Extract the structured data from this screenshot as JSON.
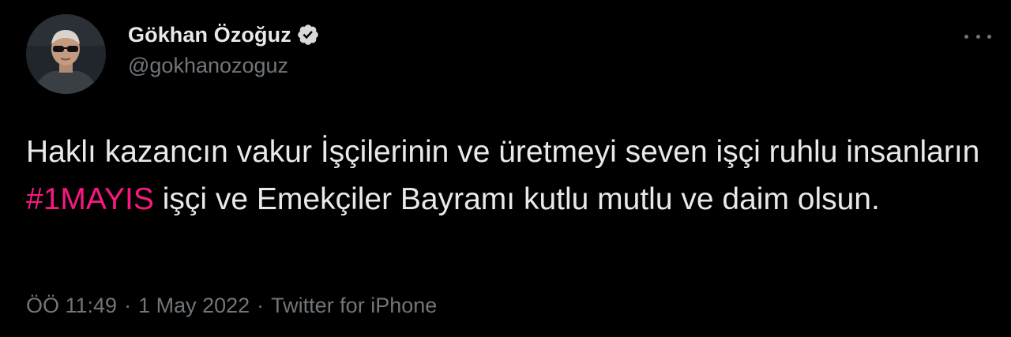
{
  "author": {
    "display_name": "Gökhan Özoğuz",
    "handle": "@gokhanozoguz",
    "verified_icon": "verified-badge-icon",
    "avatar": "profile-avatar"
  },
  "more_menu": {
    "icon": "more-dots-icon"
  },
  "tweet": {
    "text_before": "Haklı kazancın vakur İşçilerinin ve üretmeyi seven işçi ruhlu insanların ",
    "hashtag": "#1MAYIS",
    "text_after": " işçi ve Emekçiler Bayramı kutlu mutlu ve daim olsun."
  },
  "meta": {
    "time": "ÖÖ 11:49",
    "separator": "·",
    "date": "1 May 2022",
    "source": "Twitter for iPhone"
  },
  "colors": {
    "background": "#000000",
    "text": "#e7e9ea",
    "muted": "#71767b",
    "hashtag": "#f91880"
  }
}
